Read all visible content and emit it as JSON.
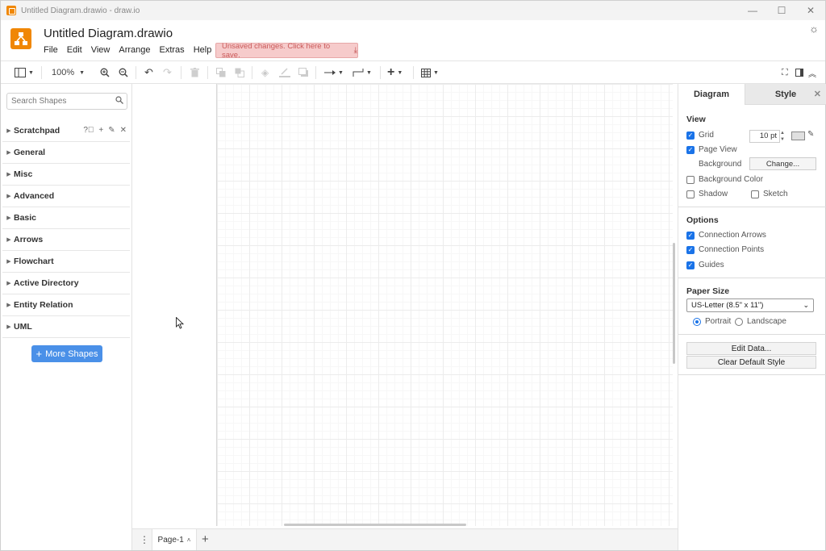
{
  "window": {
    "title": "Untitled Diagram.drawio - draw.io",
    "controls": [
      "—",
      "☐",
      "✕"
    ]
  },
  "header": {
    "document_title": "Untitled Diagram.drawio",
    "menu": [
      "File",
      "Edit",
      "View",
      "Arrange",
      "Extras",
      "Help"
    ],
    "unsaved_notice": "Unsaved changes. Click here to save."
  },
  "toolbar": {
    "zoom": "100%"
  },
  "shapes_panel": {
    "search_placeholder": "Search Shapes",
    "categories": [
      "Scratchpad",
      "General",
      "Misc",
      "Advanced",
      "Basic",
      "Arrows",
      "Flowchart",
      "Active Directory",
      "Entity Relation",
      "UML"
    ],
    "more_shapes_label": "More Shapes"
  },
  "pages": {
    "current": "Page-1"
  },
  "format_panel": {
    "tabs": [
      "Diagram",
      "Style"
    ],
    "view": {
      "title": "View",
      "grid_label": "Grid",
      "grid_checked": true,
      "grid_size": "10 pt",
      "page_view_label": "Page View",
      "page_view_checked": true,
      "background_label": "Background",
      "change_button": "Change...",
      "background_color_label": "Background Color",
      "shadow_label": "Shadow",
      "sketch_label": "Sketch"
    },
    "options": {
      "title": "Options",
      "connection_arrows": "Connection Arrows",
      "connection_points": "Connection Points",
      "guides": "Guides"
    },
    "paper_size": {
      "title": "Paper Size",
      "selected": "US-Letter (8.5\" x 11\")",
      "portrait": "Portrait",
      "landscape": "Landscape",
      "orientation": "Portrait"
    },
    "edit_data_button": "Edit Data...",
    "clear_default_style_button": "Clear Default Style"
  },
  "colors": {
    "accent": "#1a73e8",
    "brand": "#f08705",
    "more_shapes_bg": "#4a90e8",
    "unsaved_bg": "#f6cbcb"
  }
}
